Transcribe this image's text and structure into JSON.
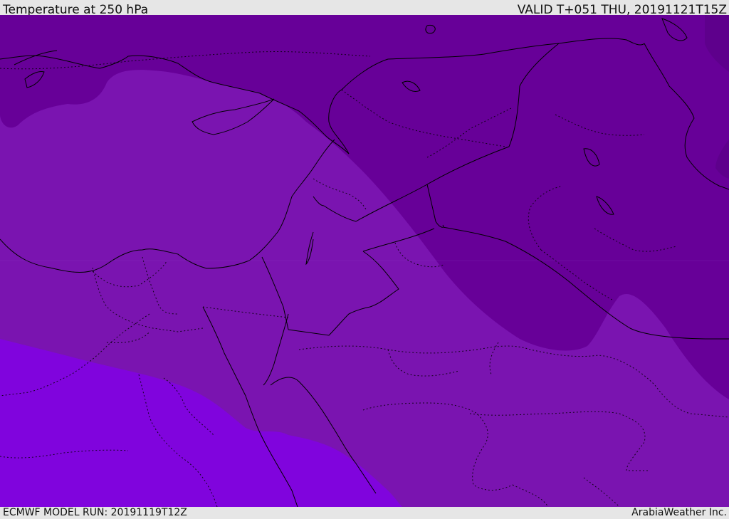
{
  "header": {
    "title": "Temperature at 250 hPa",
    "valid": "VALID T+051 THU, 20191121T15Z"
  },
  "footer": {
    "model_run": "ECMWF MODEL RUN: 20191119T12Z",
    "credit": "ArabiaWeather Inc."
  },
  "map": {
    "field": "temperature",
    "level": "250 hPa",
    "region": "Eastern Mediterranean / Middle East",
    "colors": {
      "band_coldest": "#670098",
      "band_cold": "#76139f",
      "band_mid": "#7a14b0",
      "band_warm": "#8004dd",
      "boundary": "#000000",
      "header_bg": "#e6e6e6"
    },
    "layers": [
      "temperature-contours",
      "coastlines",
      "country-borders",
      "admin-borders"
    ]
  }
}
